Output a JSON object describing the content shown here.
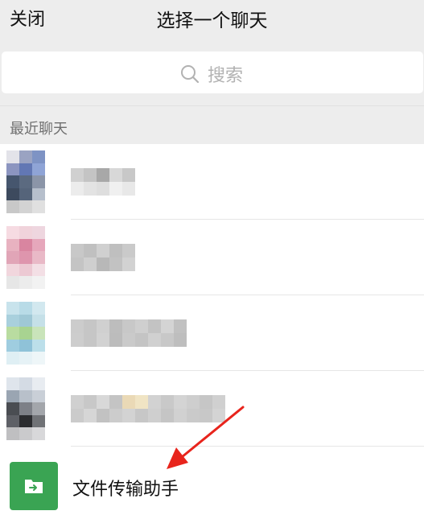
{
  "header": {
    "close_label": "关闭",
    "title": "选择一个聊天"
  },
  "search": {
    "placeholder": "搜索",
    "icon": "search-icon"
  },
  "section": {
    "label": "最近聊天"
  },
  "recent_chats": [
    {
      "name": "",
      "avatar_colors": [
        "#e3e3e9",
        "#9aa3c2",
        "#7e93c4",
        "#ffffff",
        "#8c95c0",
        "#6277b4",
        "#8fa4d6",
        "#ffffff",
        "#46566e",
        "#5b6a80",
        "#8b95a8",
        "#ffffff",
        "#3d4a5e",
        "#55647a",
        "#b6bfcc",
        "#ffffff",
        "#c8c8c8",
        "#d3d3d3",
        "#e0e0e0",
        "#ffffff"
      ],
      "name_blocks": [
        "#d0d0d0",
        "#c4c4c4",
        "#a8a8a8",
        "#d8d8d8",
        "#c8c8c8",
        "#ececec",
        "#e3e3e3",
        "#dedede",
        "#f0f0f0",
        "#e8e8e8"
      ]
    },
    {
      "name": "",
      "avatar_colors": [
        "#f6dbe2",
        "#f0d3db",
        "#eed6df",
        "#ffffff",
        "#e8b2c0",
        "#d985a0",
        "#e6a7bb",
        "#ffffff",
        "#e1a5b7",
        "#de95ad",
        "#e9b9c7",
        "#ffffff",
        "#f1d6dd",
        "#ecc9d3",
        "#f3dfe5",
        "#ffffff",
        "#e6e6e6",
        "#ececec",
        "#f2f2f2",
        "#ffffff"
      ],
      "name_blocks": [
        "#c8c8c8",
        "#c0c0c0",
        "#d0d0d0",
        "#bfbfbf",
        "#cacaca",
        "#c4c4c4",
        "#cfcfcf",
        "#b8b8b8",
        "#c2c2c2",
        "#d2d2d2"
      ]
    },
    {
      "name": "",
      "avatar_colors": [
        "#c8e3ec",
        "#b8dbe7",
        "#d2e8ef",
        "#ffffff",
        "#a9d0dd",
        "#9fc8d6",
        "#c5e0e8",
        "#ffffff",
        "#b9dca0",
        "#a8d391",
        "#c9e4ba",
        "#ffffff",
        "#9fcde0",
        "#8fc2d8",
        "#bcdfea",
        "#ffffff",
        "#dfeff4",
        "#e6f2f6",
        "#eef6f8",
        "#ffffff"
      ],
      "name_blocks": [
        "#cccccc",
        "#c6c6c6",
        "#d0d0d0",
        "#bdbdbd",
        "#c8c8c8",
        "#cfcfcf",
        "#c3c3c3",
        "#d4d4d4",
        "#c1c1c1",
        "#cdcdcd",
        "#c6c6c6",
        "#d2d2d2",
        "#bcbcbc",
        "#cacaca",
        "#c4c4c4",
        "#d0d0d0",
        "#c8c8c8",
        "#bebebe"
      ]
    },
    {
      "name": "",
      "avatar_colors": [
        "#dfe5ec",
        "#d4dbe4",
        "#e8ecf1",
        "#ffffff",
        "#9aa5b2",
        "#b8c0ca",
        "#c9cfd7",
        "#ffffff",
        "#4a4d52",
        "#7d8087",
        "#a3a6ab",
        "#ffffff",
        "#5e6066",
        "#2b2c2f",
        "#707276",
        "#ffffff",
        "#bfbfc1",
        "#cacacc",
        "#d8d8da",
        "#ffffff"
      ],
      "name_blocks": [
        "#d0d0d0",
        "#c8c8c8",
        "#d8d8d8",
        "#c4c4c4",
        "#ead9b6",
        "#f0e4c4",
        "#d2d2d2",
        "#c9c9c9",
        "#d4d4d4",
        "#cecece",
        "#c6c6c6",
        "#d0d0d0",
        "#cbcbcb",
        "#d6d6d6",
        "#c2c2c2",
        "#cccccc",
        "#d3d3d3",
        "#c7c7c7",
        "#cfcfcf",
        "#c5c5c5",
        "#d1d1d1",
        "#cacaca",
        "#c8c8c8",
        "#d4d4d4"
      ]
    }
  ],
  "file_transfer": {
    "label": "文件传输助手",
    "icon": "folder-transfer-icon",
    "color": "#3aa453"
  },
  "annotation": {
    "icon": "red-arrow-icon",
    "color": "#e8241c"
  }
}
